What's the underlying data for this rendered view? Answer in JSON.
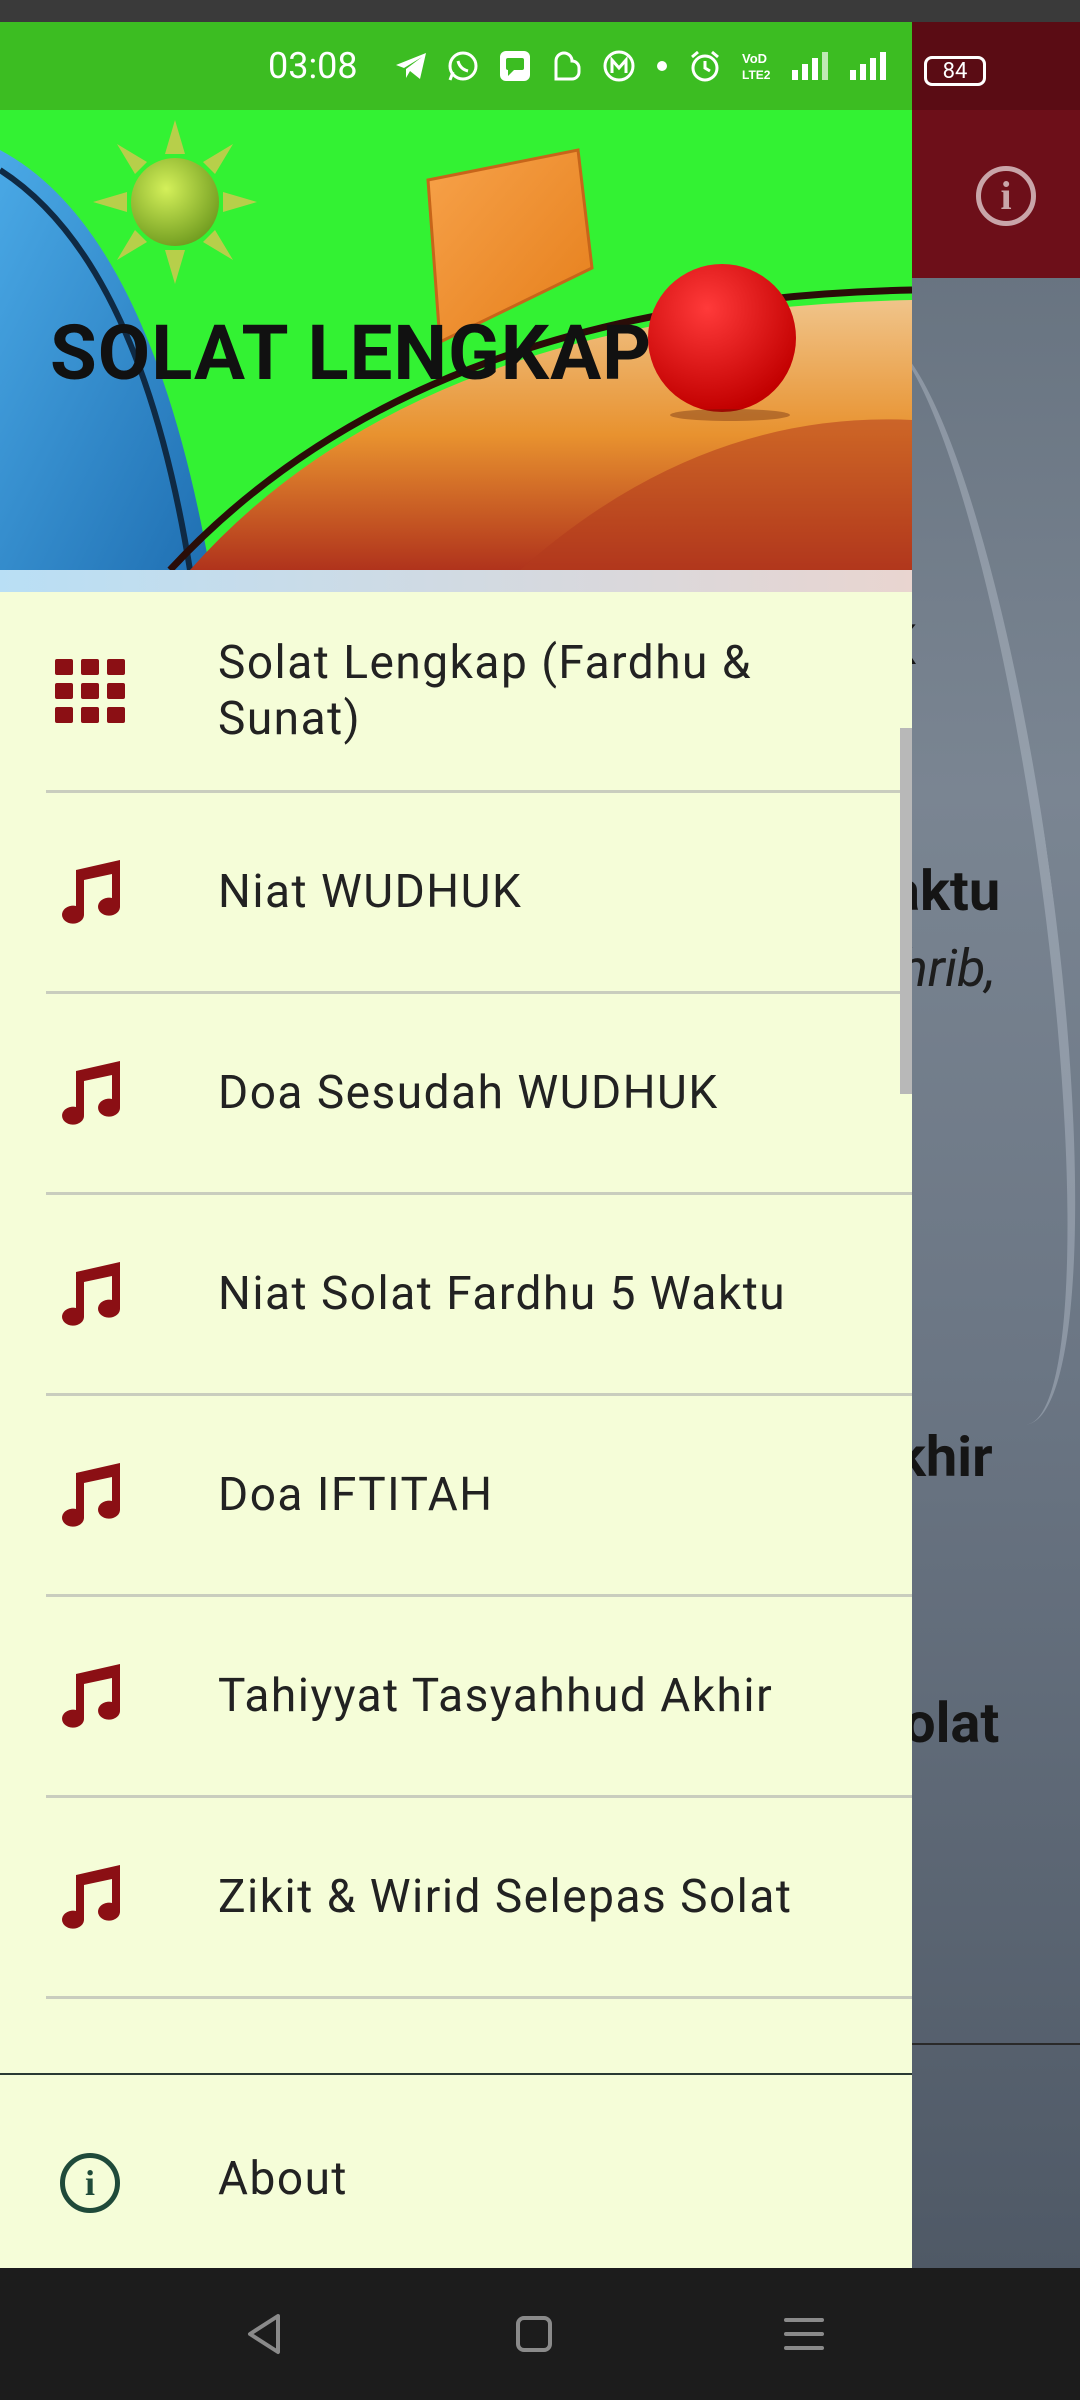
{
  "status_bar": {
    "time": "03:08",
    "battery": "84"
  },
  "background_app": {
    "fragments": [
      "K",
      "aktu",
      "hrib,",
      "khir",
      "olat"
    ]
  },
  "drawer": {
    "header_title": "SOLAT LENGKAP",
    "menu_items": [
      {
        "label": "Solat Lengkap (Fardhu & Sunat)",
        "icon": "grid-icon"
      },
      {
        "label": "Niat WUDHUK",
        "icon": "music-note-icon"
      },
      {
        "label": "Doa Sesudah WUDHUK",
        "icon": "music-note-icon"
      },
      {
        "label": "Niat Solat Fardhu 5 Waktu",
        "icon": "music-note-icon"
      },
      {
        "label": "Doa IFTITAH",
        "icon": "music-note-icon"
      },
      {
        "label": "Tahiyyat Tasyahhud Akhir",
        "icon": "music-note-icon"
      },
      {
        "label": "Zikit & Wirid Selepas Solat",
        "icon": "music-note-icon"
      }
    ],
    "about_label": "About"
  },
  "colors": {
    "drawer_bg": "#f5fdd8",
    "accent_icon": "#8b0f14",
    "status_bar_drawer": "#3cbd22",
    "header_bg": "#33f233",
    "app_toolbar": "#6d0f19"
  }
}
